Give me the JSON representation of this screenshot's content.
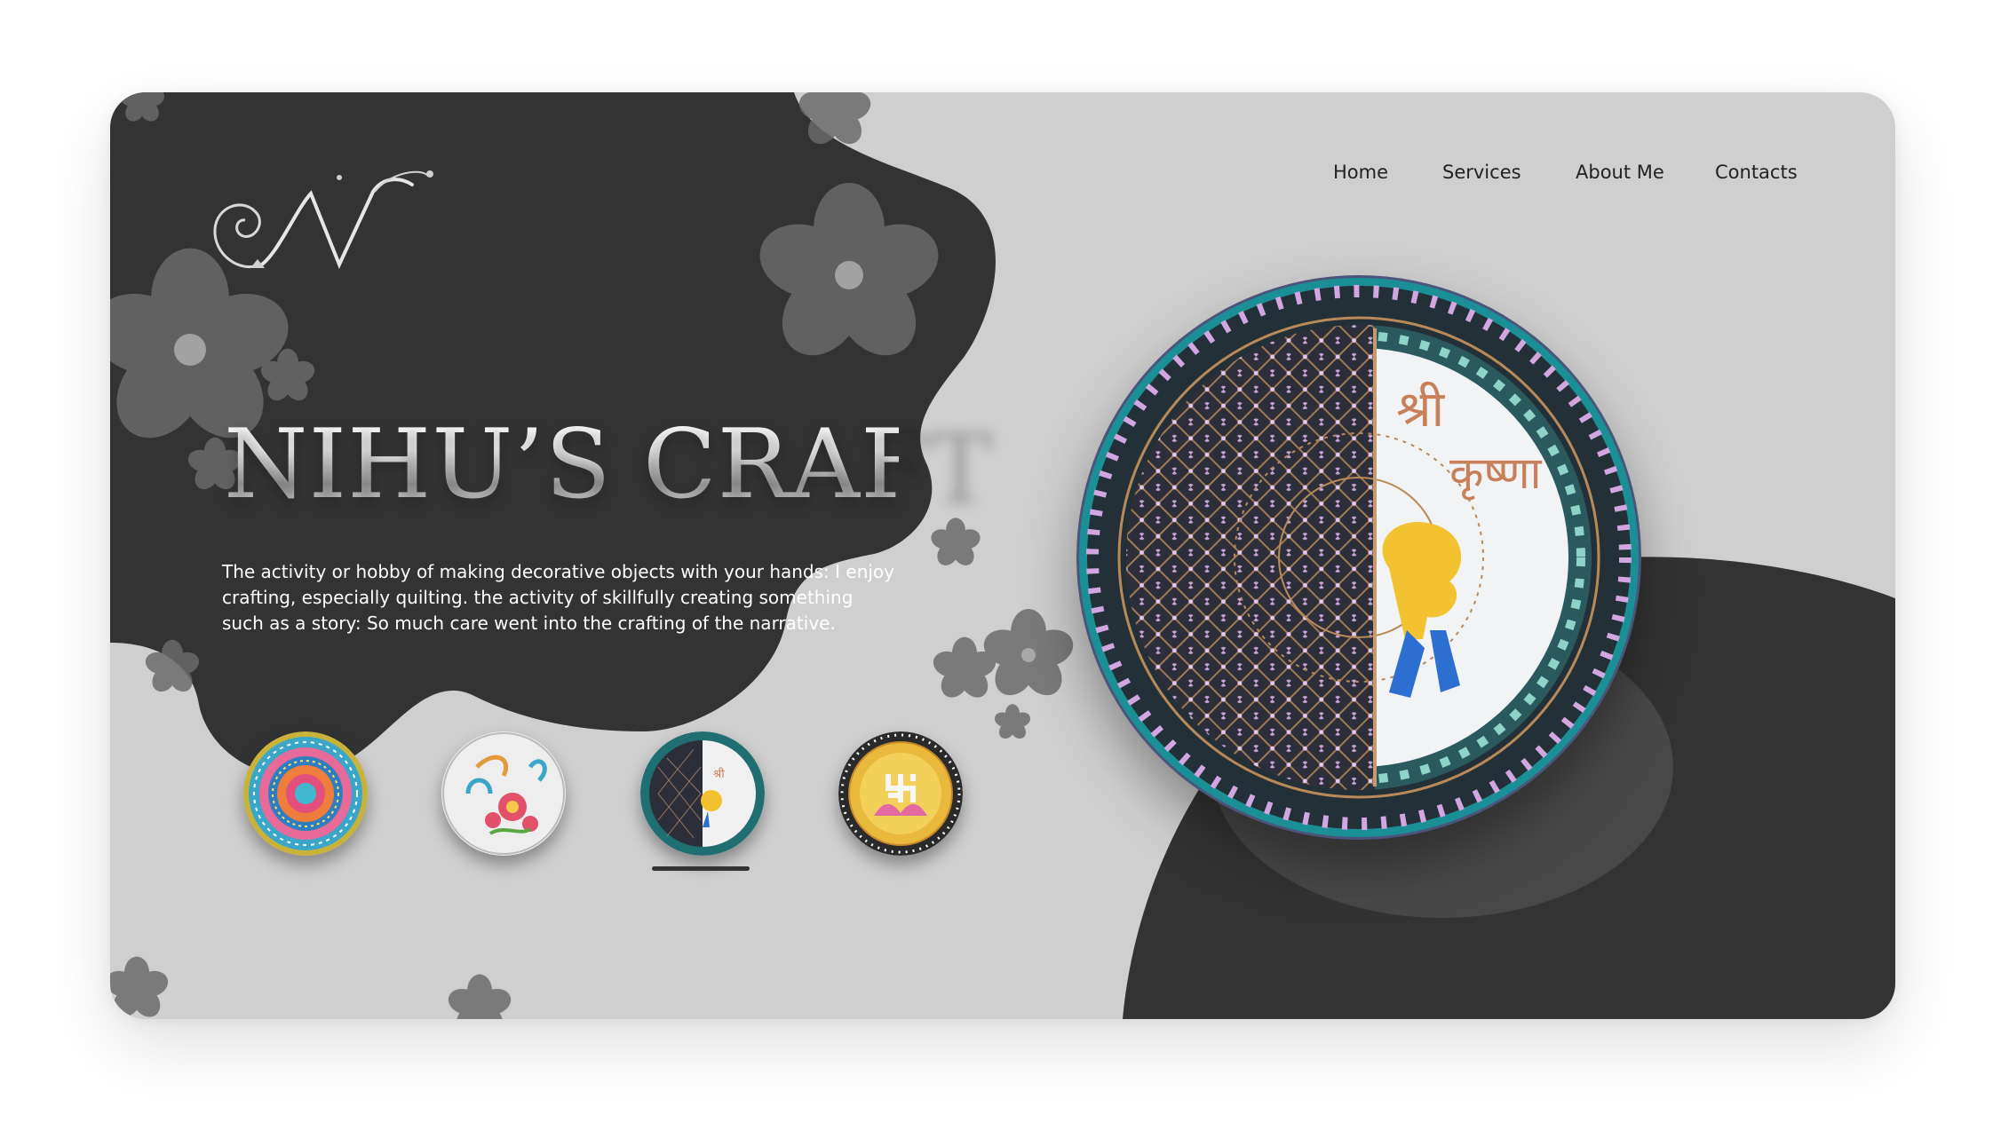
{
  "brand": {
    "logo_icon": "script-n-monogram-icon",
    "title": "NIHU’S CRAFT",
    "description": "The activity or hobby of making decorative objects with your hands: I enjoy crafting, especially quilting. the activity of skillfully creating something such as a story: So much care went into the crafting of the narrative."
  },
  "nav": {
    "items": [
      {
        "label": "Home"
      },
      {
        "label": "Services"
      },
      {
        "label": "About Me"
      },
      {
        "label": "Contacts"
      }
    ]
  },
  "gallery": {
    "thumbnails": [
      {
        "name": "mandala-plate",
        "selected": false
      },
      {
        "name": "quilled-floral-plate",
        "selected": false
      },
      {
        "name": "krishna-lippan-plate",
        "selected": true
      },
      {
        "name": "swastik-lotus-plate",
        "selected": false
      }
    ],
    "hero_text_1": "श्री",
    "hero_text_2": "कृष्णा"
  },
  "colors": {
    "background": "#cfcfcf",
    "dark_shape": "#333333",
    "flower": "#6d6d6d",
    "text_dark": "#222222",
    "text_light": "#ffffff"
  }
}
